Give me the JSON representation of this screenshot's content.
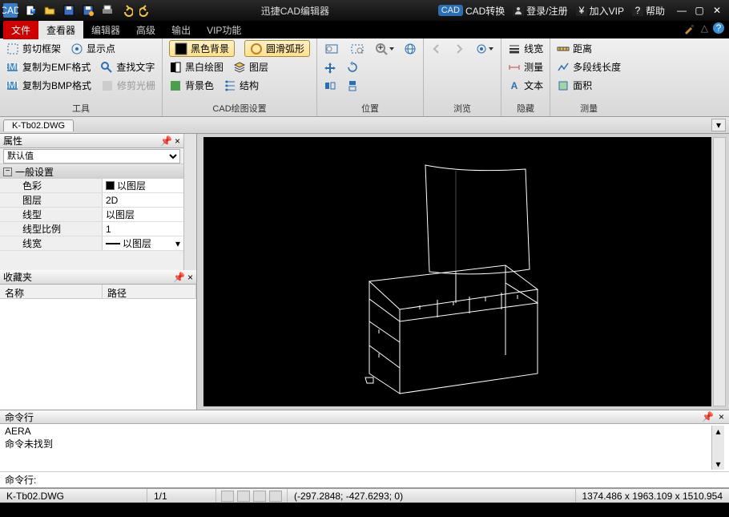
{
  "app": {
    "title": "迅捷CAD编辑器"
  },
  "titlebar_links": {
    "cad_convert": "CAD转换",
    "login": "登录/注册",
    "vip": "加入VIP",
    "help": "帮助"
  },
  "menus": {
    "file": "文件",
    "viewer": "查看器",
    "editor": "编辑器",
    "advanced": "高级",
    "output": "输出",
    "vip": "VIP功能"
  },
  "ribbon": {
    "tools": {
      "label": "工具",
      "cut_frame": "剪切框架",
      "copy_emf": "复制为EMF格式",
      "copy_bmp": "复制为BMP格式",
      "show_point": "显示点",
      "find_text": "查找文字",
      "trim": "修剪光栅"
    },
    "cad_settings": {
      "label": "CAD绘图设置",
      "black_bg": "黑色背景",
      "smooth_arc": "圆滑弧形",
      "bw_draw": "黑白绘图",
      "layer": "图层",
      "bg_color": "背景色",
      "structure": "结构"
    },
    "position": {
      "label": "位置"
    },
    "browse": {
      "label": "浏览"
    },
    "hide": {
      "label": "隐藏",
      "linewidth": "线宽",
      "measure": "测量",
      "text": "文本"
    },
    "measure": {
      "label": "测量",
      "distance": "距离",
      "polyline_len": "多段线长度",
      "area": "面积"
    }
  },
  "doc_tab": "K-Tb02.DWG",
  "panels": {
    "properties": "属性",
    "default": "默认值",
    "general": "一般设置",
    "rows": {
      "color": {
        "name": "色彩",
        "value": "以图层"
      },
      "layer": {
        "name": "图层",
        "value": "2D"
      },
      "linetype": {
        "name": "线型",
        "value": "以图层"
      },
      "linescale": {
        "name": "线型比例",
        "value": "1"
      },
      "lineweight": {
        "name": "线宽",
        "value": "以图层"
      }
    },
    "collections": "收藏夹",
    "cols": {
      "name": "名称",
      "path": "路径"
    }
  },
  "cmd": {
    "header": "命令行",
    "history1": "AERA",
    "history2": "命令未找到",
    "prompt": "命令行:"
  },
  "status": {
    "file": "K-Tb02.DWG",
    "page": "1/1",
    "coords": "(-297.2848; -427.6293; 0)",
    "dims": "1374.486 x 1963.109 x 1510.954"
  }
}
